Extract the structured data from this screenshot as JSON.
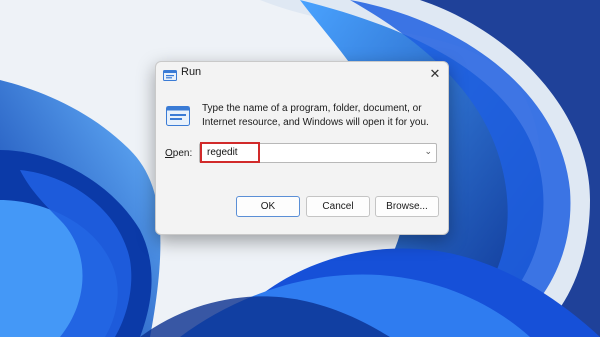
{
  "desktop": {
    "wallpaper": "windows-11-bloom",
    "colors": {
      "background": "#eef2f7",
      "bloom_dark": "#0a2f8f",
      "bloom_mid": "#1f5fe0",
      "bloom_light": "#4aa3ff"
    }
  },
  "dialog": {
    "title": "Run",
    "title_icon": "run-icon",
    "close_icon": "close-icon",
    "description": "Type the name of a program, folder, document, or Internet resource, and Windows will open it for you.",
    "open_label": "Open:",
    "open_accesskey": "O",
    "open_label_rest": "pen:",
    "input_value": "regedit",
    "input_dropdown_icon": "chevron-down-icon",
    "highlight_color": "#d12a2a",
    "buttons": {
      "ok": "OK",
      "cancel": "Cancel",
      "browse": "Browse..."
    }
  }
}
